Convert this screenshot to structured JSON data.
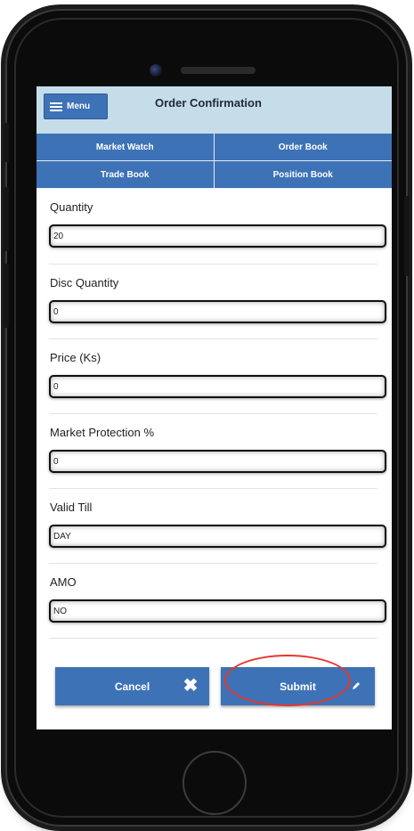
{
  "header": {
    "menu_label": "Menu",
    "title": "Order Confirmation"
  },
  "nav": {
    "items": [
      "Market Watch",
      "Order Book",
      "Trade Book",
      "Position Book"
    ]
  },
  "form": {
    "fields": [
      {
        "label": "Quantity",
        "value": "20"
      },
      {
        "label": "Disc Quantity",
        "value": "0"
      },
      {
        "label": "Price (Ks)",
        "value": "0"
      },
      {
        "label": "Market Protection %",
        "value": "0"
      },
      {
        "label": "Valid Till",
        "value": "DAY"
      },
      {
        "label": "AMO",
        "value": "NO"
      }
    ]
  },
  "actions": {
    "cancel_label": "Cancel",
    "submit_label": "Submit"
  },
  "colors": {
    "primary": "#3d72b6",
    "topbar": "#c5dce9",
    "highlight": "#e8352b"
  },
  "icons": [
    "hamburger-icon",
    "close-icon",
    "pencil-icon"
  ]
}
